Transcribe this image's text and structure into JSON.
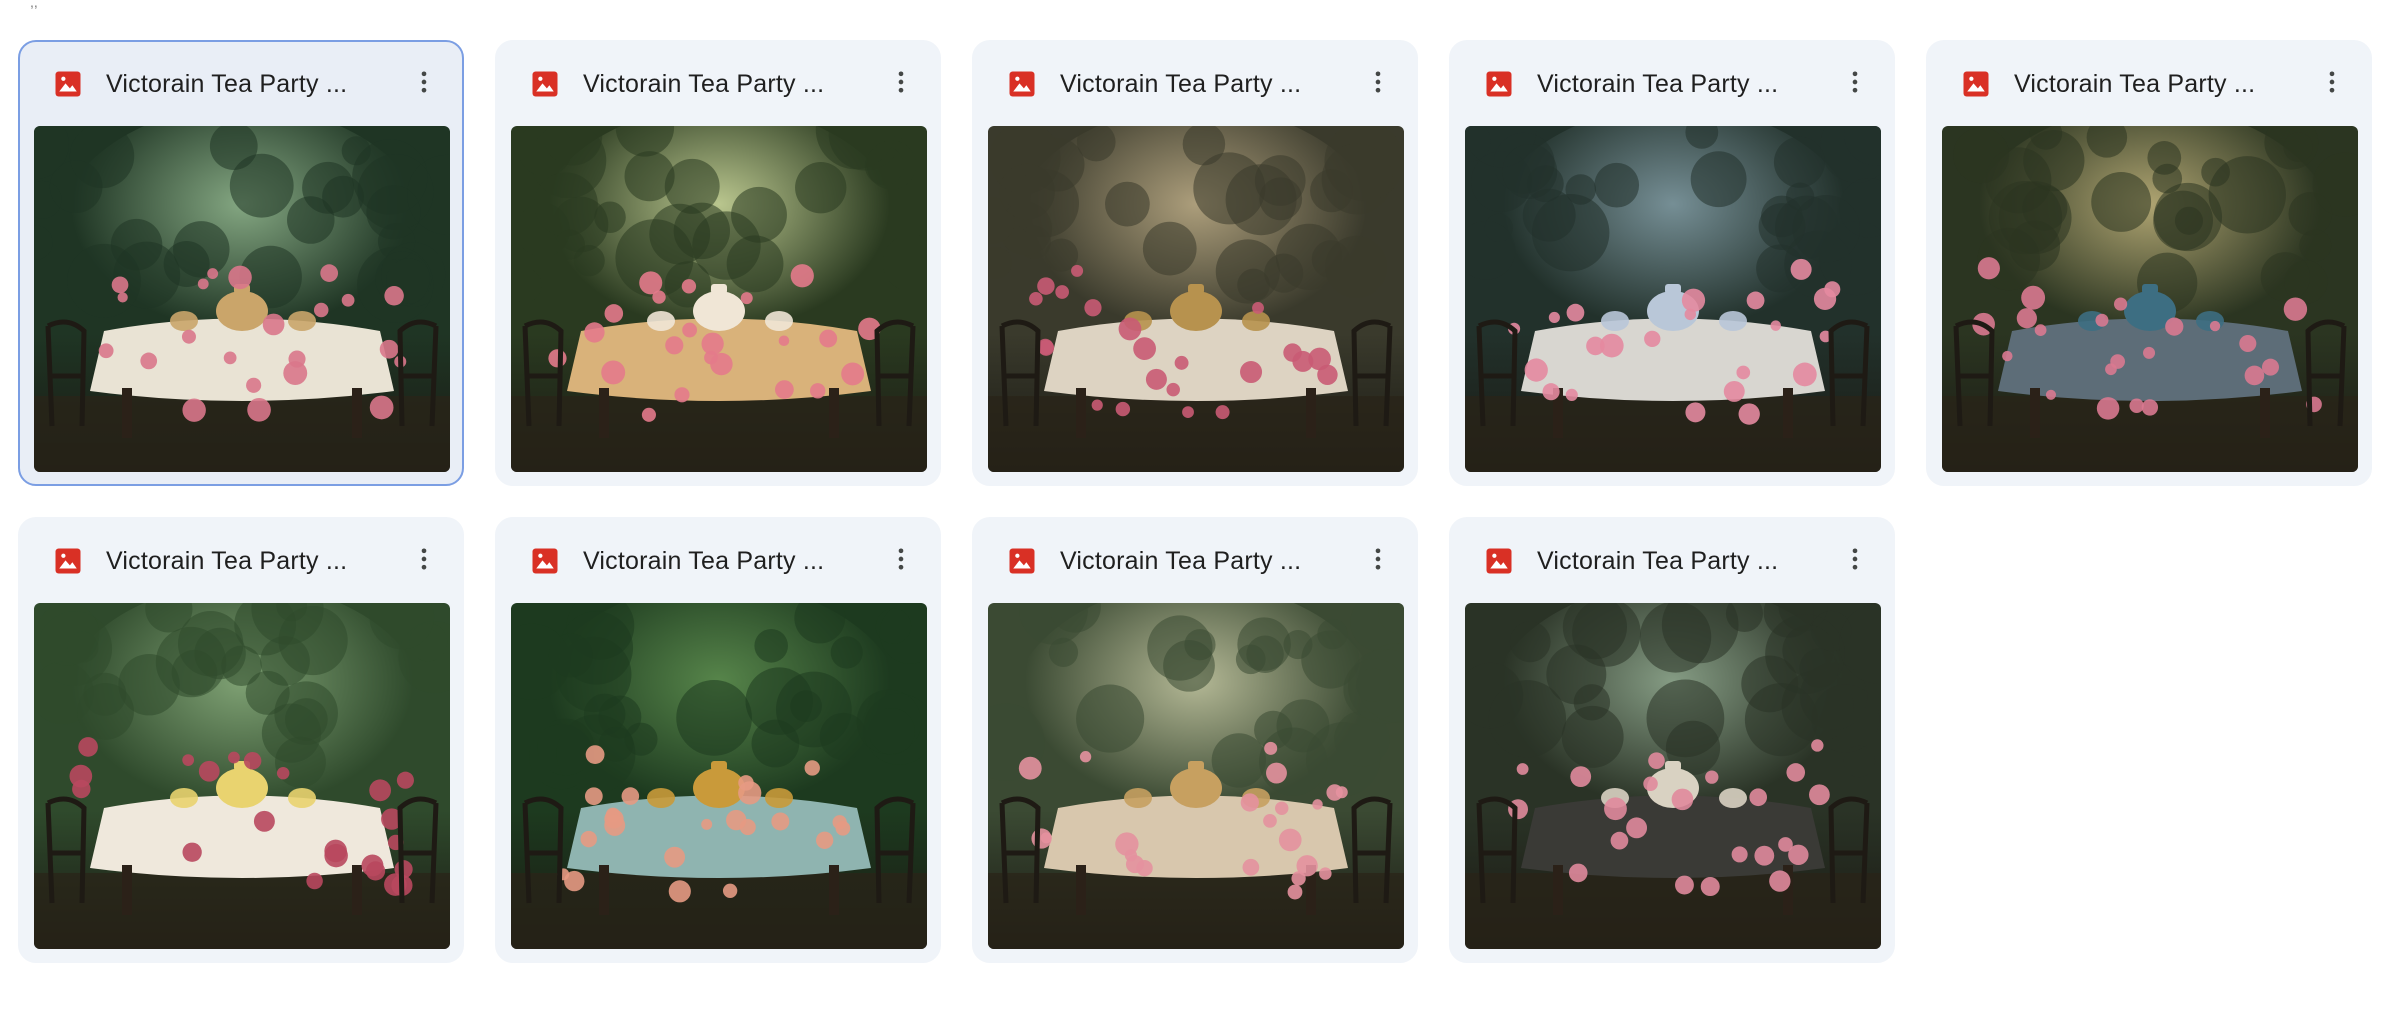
{
  "files": [
    {
      "title": "Victorain Tea Party ...",
      "selected": true,
      "icon": "image-file-icon",
      "scene": {
        "bg": "#1f3524",
        "light": "#8fb38c",
        "table": "#e9e3d4",
        "flowers": "#d9778b",
        "accent": "#caa56a"
      }
    },
    {
      "title": "Victorain Tea Party ...",
      "selected": false,
      "icon": "image-file-icon",
      "scene": {
        "bg": "#2a3a20",
        "light": "#c9d59a",
        "table": "#d9b27a",
        "flowers": "#e37a8b",
        "accent": "#f0e6d6"
      }
    },
    {
      "title": "Victorain Tea Party ...",
      "selected": false,
      "icon": "image-file-icon",
      "scene": {
        "bg": "#3a3a2c",
        "light": "#b9a984",
        "table": "#ddd3c2",
        "flowers": "#c95b74",
        "accent": "#b7924e"
      }
    },
    {
      "title": "Victorain Tea Party ...",
      "selected": false,
      "icon": "image-file-icon",
      "scene": {
        "bg": "#22312b",
        "light": "#7f99a1",
        "table": "#d8d6d0",
        "flowers": "#e48aa0",
        "accent": "#b9c7d8"
      }
    },
    {
      "title": "Victorain Tea Party ...",
      "selected": false,
      "icon": "image-file-icon",
      "scene": {
        "bg": "#2b3521",
        "light": "#bdb07a",
        "table": "#5d6d78",
        "flowers": "#d97990",
        "accent": "#3d6e82"
      }
    },
    {
      "title": "Victorain Tea Party ...",
      "selected": false,
      "icon": "image-file-icon",
      "scene": {
        "bg": "#2f4a2c",
        "light": "#88ab7c",
        "table": "#efe8dc",
        "flowers": "#b8485e",
        "accent": "#e9d36f"
      }
    },
    {
      "title": "Victorain Tea Party ...",
      "selected": false,
      "icon": "image-file-icon",
      "scene": {
        "bg": "#1d3a1f",
        "light": "#5d8d4f",
        "table": "#8fb4b0",
        "flowers": "#e69a83",
        "accent": "#c99a3a"
      }
    },
    {
      "title": "Victorain Tea Party ...",
      "selected": false,
      "icon": "image-file-icon",
      "scene": {
        "bg": "#3b4a33",
        "light": "#c1c4a0",
        "table": "#d8c7ad",
        "flowers": "#e4919f",
        "accent": "#c7a060"
      }
    },
    {
      "title": "Victorain Tea Party ...",
      "selected": false,
      "icon": "image-file-icon",
      "scene": {
        "bg": "#2a3326",
        "light": "#8fa78e",
        "table": "#3a3a36",
        "flowers": "#e08a9c",
        "accent": "#d9d2c2"
      }
    }
  ],
  "colors": {
    "card_bg": "#f0f4f9",
    "selected_bg": "#e9eef6",
    "selected_border": "#7b9ee3",
    "image_icon": "#d93025",
    "title_text": "#1f1f1f",
    "more_icon": "#444746"
  }
}
